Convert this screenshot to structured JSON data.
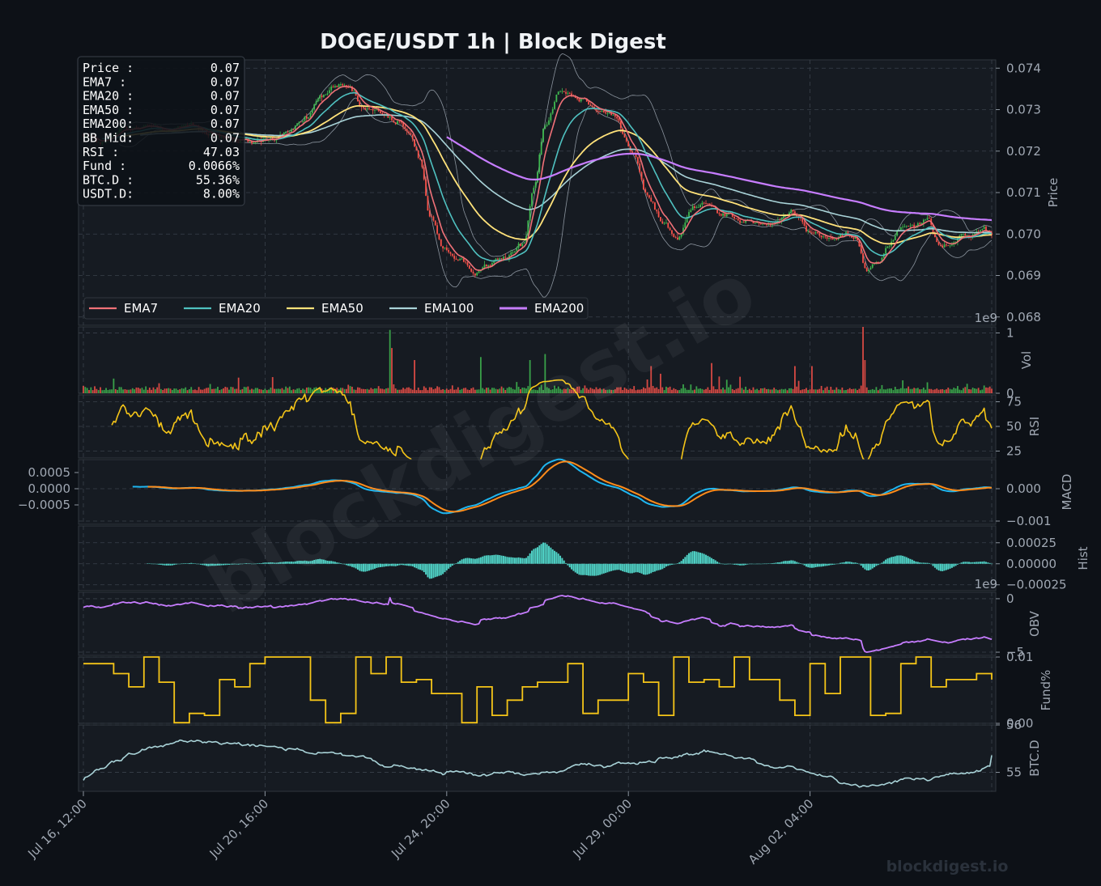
{
  "page": {
    "title": "DOGE/USDT  1h  |  Block Digest",
    "watermark": "blockdigest.io",
    "footer": "blockdigest.io"
  },
  "colors": {
    "background": "#0d1117",
    "panel": "#161b22",
    "grid": "#3a414b",
    "up": "#3fb950",
    "down": "#f85149",
    "ema7": "#f07178",
    "ema20": "#4fc1c0",
    "ema50": "#ffe27a",
    "ema100": "#a9d3d8",
    "ema200": "#c77dff",
    "rsi": "#f5c518",
    "macd": "#1fb6f0",
    "signal": "#ff8c1a",
    "hist": "#4fd1c5",
    "obv": "#c77dff",
    "funding": "#f5c518",
    "btcd": "#a9d3d8"
  },
  "info_box": [
    {
      "label": "Price :",
      "value": "0.07"
    },
    {
      "label": "EMA7  :",
      "value": "0.07"
    },
    {
      "label": "EMA20 :",
      "value": "0.07"
    },
    {
      "label": "EMA50 :",
      "value": "0.07"
    },
    {
      "label": "EMA200:",
      "value": "0.07"
    },
    {
      "label": "BB Mid:",
      "value": "0.07"
    },
    {
      "label": "RSI   :",
      "value": "47.03"
    },
    {
      "label": "Fund  :",
      "value": "0.0066%"
    },
    {
      "label": "BTC.D :",
      "value": "55.36%"
    },
    {
      "label": "USDT.D:",
      "value": "8.00%"
    }
  ],
  "chart_data": {
    "type": "line",
    "title": "DOGE/USDT  1h  |  Block Digest",
    "x_ticks": [
      "Jul 16, 12:00",
      "Jul 20, 16:00",
      "Jul 24, 20:00",
      "Jul 29, 00:00",
      "Aug 02, 04:00"
    ],
    "x_range_hours": [
      0,
      480
    ],
    "grid": true,
    "legend": {
      "placement": "lower-left",
      "entries": [
        "EMA7",
        "EMA20",
        "EMA50",
        "EMA100",
        "EMA200"
      ]
    },
    "panels": {
      "price": {
        "ylabel": "Price",
        "ylim": [
          0.0678,
          0.0742
        ],
        "yticks": [
          "0.068",
          "0.069",
          "0.070",
          "0.071",
          "0.072",
          "0.073",
          "0.074"
        ],
        "close_anchors": [
          [
            0,
            0.0724
          ],
          [
            10,
            0.0722
          ],
          [
            22,
            0.0725
          ],
          [
            40,
            0.0726
          ],
          [
            55,
            0.0726
          ],
          [
            70,
            0.0724
          ],
          [
            85,
            0.0722
          ],
          [
            100,
            0.0723
          ],
          [
            110,
            0.0725
          ],
          [
            118,
            0.0728
          ],
          [
            125,
            0.0733
          ],
          [
            132,
            0.0735
          ],
          [
            140,
            0.0735
          ],
          [
            148,
            0.073
          ],
          [
            158,
            0.0729
          ],
          [
            166,
            0.0727
          ],
          [
            172,
            0.0724
          ],
          [
            178,
            0.0718
          ],
          [
            183,
            0.0705
          ],
          [
            190,
            0.0697
          ],
          [
            198,
            0.0693
          ],
          [
            206,
            0.0691
          ],
          [
            214,
            0.0693
          ],
          [
            222,
            0.0694
          ],
          [
            228,
            0.0696
          ],
          [
            233,
            0.0698
          ],
          [
            238,
            0.0712
          ],
          [
            244,
            0.0727
          ],
          [
            252,
            0.0735
          ],
          [
            262,
            0.0733
          ],
          [
            270,
            0.0731
          ],
          [
            280,
            0.0729
          ],
          [
            290,
            0.072
          ],
          [
            298,
            0.0709
          ],
          [
            306,
            0.0703
          ],
          [
            314,
            0.0699
          ],
          [
            322,
            0.0706
          ],
          [
            330,
            0.0708
          ],
          [
            338,
            0.0705
          ],
          [
            350,
            0.0703
          ],
          [
            362,
            0.0702
          ],
          [
            374,
            0.0705
          ],
          [
            386,
            0.07
          ],
          [
            398,
            0.0699
          ],
          [
            408,
            0.0699
          ],
          [
            414,
            0.0691
          ],
          [
            420,
            0.0693
          ],
          [
            426,
            0.0698
          ],
          [
            432,
            0.0702
          ],
          [
            440,
            0.0703
          ],
          [
            446,
            0.0704
          ],
          [
            452,
            0.0698
          ],
          [
            458,
            0.0698
          ],
          [
            466,
            0.07
          ],
          [
            476,
            0.07
          ],
          [
            480,
            0.0699
          ]
        ],
        "ema7_end": 0.07,
        "ema20_end": 0.07,
        "ema50_end": 0.0701,
        "ema100_end": 0.0701,
        "ema200_end": 0.07025
      },
      "volume": {
        "ylabel": "Vol",
        "ylim": [
          0,
          1100000000.0
        ],
        "yticks": [
          "0",
          "1"
        ],
        "offset_label": "1e9"
      },
      "rsi": {
        "ylabel": "RSI",
        "ylim": [
          18,
          82
        ],
        "yticks": [
          "25",
          "50",
          "75"
        ],
        "last": 47.03
      },
      "macd": {
        "ylabel": "MACD",
        "ylim": [
          -0.0011,
          0.0009
        ],
        "left_yticks": [
          "0.0005",
          "0.0000",
          "−0.0005"
        ],
        "right_yticks": [
          "0.000",
          "−0.001"
        ]
      },
      "hist": {
        "ylabel": "Hist",
        "ylim": [
          -0.00032,
          0.00045
        ],
        "yticks": [
          "0.00025",
          "0.00000",
          "−0.00025"
        ]
      },
      "obv": {
        "ylabel": "OBV",
        "ylim": [
          -5300000000.0,
          600000000.0
        ],
        "yticks": [
          "0",
          "−5"
        ],
        "offset_label": "1e9"
      },
      "funding": {
        "ylabel": "Fund%",
        "ylim": [
          0,
          0.01
        ],
        "yticks": [
          "0.01",
          "0.00"
        ],
        "last": 0.0066
      },
      "btcd": {
        "ylabel": "BTC.D",
        "ylim": [
          54.6,
          56.0
        ],
        "yticks": [
          "55",
          "56"
        ],
        "last": 55.36
      }
    }
  }
}
